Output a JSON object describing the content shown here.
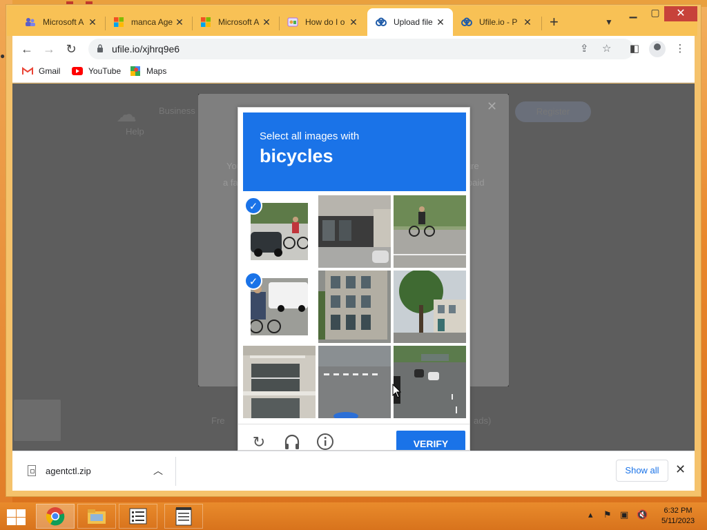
{
  "browser": {
    "tabs": [
      {
        "title": "Microsoft A",
        "icon": "teams-icon",
        "active": false
      },
      {
        "title": "manca Age",
        "icon": "microsoft-icon",
        "active": false
      },
      {
        "title": "Microsoft A",
        "icon": "microsoft-icon",
        "active": false
      },
      {
        "title": "How do I o",
        "icon": "generic-site-icon",
        "active": false
      },
      {
        "title": "Upload file",
        "icon": "ufile-icon",
        "active": true
      },
      {
        "title": "Ufile.io - P",
        "icon": "ufile-icon",
        "active": false
      }
    ],
    "url": "ufile.io/xjhrq9e6",
    "bookmarks": [
      {
        "label": "Gmail",
        "icon": "gmail-icon"
      },
      {
        "label": "YouTube",
        "icon": "youtube-icon"
      },
      {
        "label": "Maps",
        "icon": "maps-icon"
      }
    ]
  },
  "page_background": {
    "nav_text_1": "Business",
    "nav_text_2": "Help",
    "register": "Register",
    "modal_text_1a": "You",
    "modal_text_1b": "ure",
    "modal_text_2a": "a fa",
    "modal_text_2b": "paid",
    "bottom_text_1": "Fre",
    "bottom_text_2": "ads)"
  },
  "captcha": {
    "instruction": "Select all images with",
    "target_object": "bicycles",
    "tiles": [
      {
        "index": 1,
        "content": "cyclist on street with car",
        "selected": true
      },
      {
        "index": 2,
        "content": "storefront corner",
        "selected": false
      },
      {
        "index": 3,
        "content": "cyclist on road by trees",
        "selected": false
      },
      {
        "index": 4,
        "content": "cyclist next to white van",
        "selected": true
      },
      {
        "index": 5,
        "content": "office building facade",
        "selected": false
      },
      {
        "index": 6,
        "content": "tree and house",
        "selected": false
      },
      {
        "index": 7,
        "content": "building balconies",
        "selected": false
      },
      {
        "index": 8,
        "content": "street crosswalk",
        "selected": false
      },
      {
        "index": 9,
        "content": "highway with cars",
        "selected": false
      }
    ],
    "verify_label": "VERIFY",
    "footer_icons": [
      "reload-icon",
      "audio-icon",
      "info-icon"
    ]
  },
  "download_bar": {
    "filename": "agentctl.zip",
    "show_all": "Show all"
  },
  "taskbar": {
    "time": "6:32 PM",
    "date": "5/11/2023"
  },
  "colors": {
    "accent": "#1a73e8",
    "taskbar": "#e07f25",
    "overlay": "#5d5d5d"
  }
}
